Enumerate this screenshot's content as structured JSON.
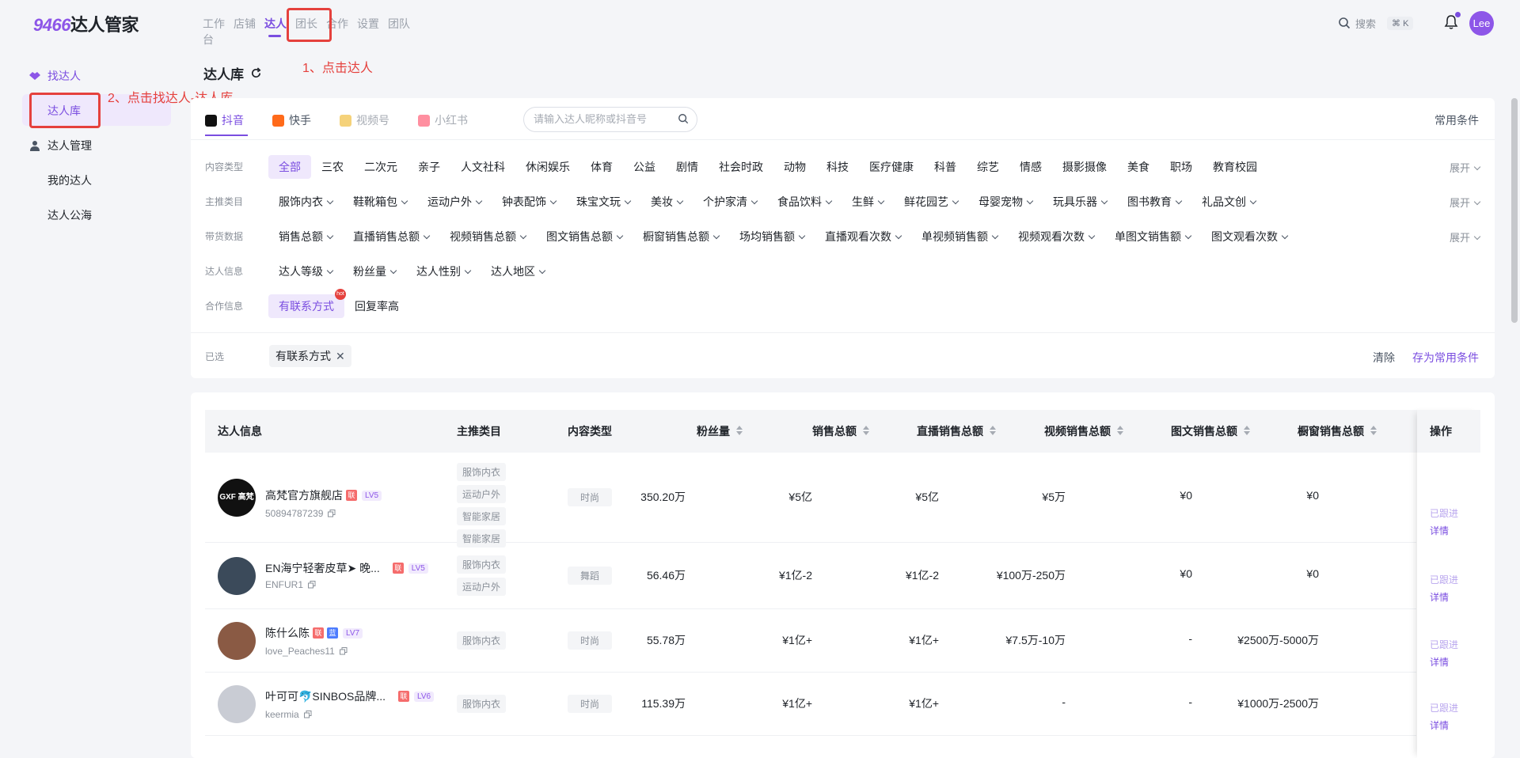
{
  "logo": {
    "num": "9466",
    "text": "达人管家"
  },
  "topnav": [
    "工作台",
    "店铺",
    "达人",
    "团长",
    "合作",
    "设置",
    "团队"
  ],
  "annotations": {
    "step1": "1、点击达人",
    "step2": "2、点击找达人-达人库"
  },
  "search": {
    "label": "搜索",
    "shortcut": "⌘ K"
  },
  "user": {
    "avatar": "Lee"
  },
  "sidebar": {
    "group1": "找达人",
    "group1_items": [
      "达人库"
    ],
    "group2": "达人管理",
    "group2_items": [
      "我的达人",
      "达人公海"
    ]
  },
  "page_title": "达人库",
  "platforms": [
    {
      "label": "抖音",
      "color": "#111111"
    },
    {
      "label": "快手",
      "color": "#ff6a1a"
    },
    {
      "label": "视频号",
      "color": "#f5b82e"
    },
    {
      "label": "小红书",
      "color": "#ff2442"
    }
  ],
  "keyword_search": {
    "placeholder": "请输入达人昵称或抖音号"
  },
  "common_conditions": "常用条件",
  "filters": {
    "content_type": {
      "label": "内容类型",
      "options": [
        "全部",
        "三农",
        "二次元",
        "亲子",
        "人文社科",
        "休闲娱乐",
        "体育",
        "公益",
        "剧情",
        "社会时政",
        "动物",
        "科技",
        "医疗健康",
        "科普",
        "综艺",
        "情感",
        "摄影摄像",
        "美食",
        "职场",
        "教育校园"
      ]
    },
    "category": {
      "label": "主推类目",
      "options": [
        "服饰内衣",
        "鞋靴箱包",
        "运动户外",
        "钟表配饰",
        "珠宝文玩",
        "美妆",
        "个护家清",
        "食品饮料",
        "生鲜",
        "鲜花园艺",
        "母婴宠物",
        "玩具乐器",
        "图书教育",
        "礼品文创"
      ]
    },
    "sales": {
      "label": "带货数据",
      "options": [
        "销售总额",
        "直播销售总额",
        "视频销售总额",
        "图文销售总额",
        "橱窗销售总额",
        "场均销售额",
        "直播观看次数",
        "单视频销售额",
        "视频观看次数",
        "单图文销售额",
        "图文观看次数"
      ]
    },
    "info": {
      "label": "达人信息",
      "options": [
        "达人等级",
        "粉丝量",
        "达人性别",
        "达人地区"
      ]
    },
    "coop": {
      "label": "合作信息",
      "options": [
        "有联系方式",
        "回复率高"
      ],
      "hot": "hot"
    },
    "expand": "展开"
  },
  "selected": {
    "label": "已选",
    "chip": "有联系方式",
    "clear": "清除",
    "save": "存为常用条件"
  },
  "table": {
    "headers": [
      "达人信息",
      "主推类目",
      "内容类型",
      "粉丝量",
      "销售总额",
      "直播销售总额",
      "视频销售总额",
      "图文销售总额",
      "橱窗销售总额",
      "操作"
    ],
    "rows": [
      {
        "name": "高梵官方旗舰店",
        "badges": [
          "联"
        ],
        "level": "LV5",
        "id": "50894787239",
        "categories": [
          "服饰内衣",
          "运动户外",
          "智能家居",
          "智能家居"
        ],
        "content": "时尚",
        "fans": "350.20万",
        "sales": "¥5亿",
        "live": "¥5亿",
        "video": "¥5万",
        "graphic": "¥0",
        "window": "¥0",
        "op1": "已跟进",
        "op2": "详情",
        "avatar_color": "#111111",
        "avatar_text": "GXF 高梵"
      },
      {
        "name": "EN海宁轻奢皮草➤ 晚...",
        "badges": [
          "联"
        ],
        "level": "LV5",
        "id": "ENFUR1",
        "categories": [
          "服饰内衣",
          "运动户外"
        ],
        "content": "舞蹈",
        "fans": "56.46万",
        "sales": "¥1亿-2",
        "live": "¥1亿-2",
        "video": "¥100万-250万",
        "graphic": "¥0",
        "window": "¥0",
        "op1": "已跟进",
        "op2": "详情",
        "avatar_color": "#3b4a5a",
        "avatar_text": ""
      },
      {
        "name": "陈什么陈",
        "badges": [
          "联",
          "蓝"
        ],
        "level": "LV7",
        "id": "love_Peaches11",
        "categories": [
          "服饰内衣"
        ],
        "content": "时尚",
        "fans": "55.78万",
        "sales": "¥1亿+",
        "live": "¥1亿+",
        "video": "¥7.5万-10万",
        "graphic": "-",
        "window": "¥2500万-5000万",
        "op1": "已跟进",
        "op2": "详情",
        "avatar_color": "#8a5a44",
        "avatar_text": ""
      },
      {
        "name": "叶可可🐬SINBOS品牌...",
        "badges": [
          "联"
        ],
        "level": "LV6",
        "id": "keermia",
        "categories": [
          "服饰内衣"
        ],
        "content": "时尚",
        "fans": "115.39万",
        "sales": "¥1亿+",
        "live": "¥1亿+",
        "video": "-",
        "graphic": "-",
        "window": "¥1000万-2500万",
        "op1": "已跟进",
        "op2": "详情",
        "avatar_color": "#c9ccd4",
        "avatar_text": ""
      }
    ]
  }
}
